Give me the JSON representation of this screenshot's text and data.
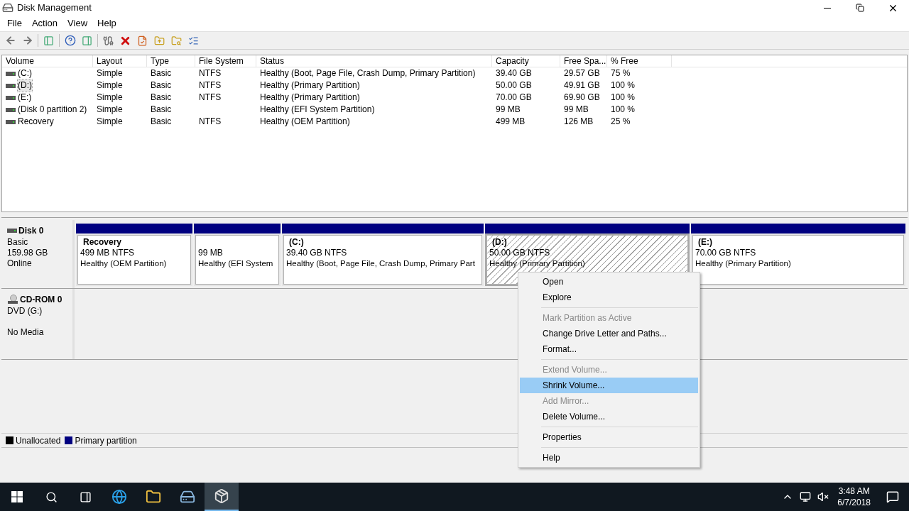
{
  "window": {
    "title": "Disk Management"
  },
  "menu": [
    "File",
    "Action",
    "View",
    "Help"
  ],
  "volumes": {
    "columns": [
      "Volume",
      "Layout",
      "Type",
      "File System",
      "Status",
      "Capacity",
      "Free Spa...",
      "% Free"
    ],
    "rows": [
      {
        "cells": [
          "(C:)",
          "Simple",
          "Basic",
          "NTFS",
          "Healthy (Boot, Page File, Crash Dump, Primary Partition)",
          "39.40 GB",
          "29.57 GB",
          "75 %"
        ],
        "selected": false
      },
      {
        "cells": [
          "(D:)",
          "Simple",
          "Basic",
          "NTFS",
          "Healthy (Primary Partition)",
          "50.00 GB",
          "49.91 GB",
          "100 %"
        ],
        "selected": true
      },
      {
        "cells": [
          "(E:)",
          "Simple",
          "Basic",
          "NTFS",
          "Healthy (Primary Partition)",
          "70.00 GB",
          "69.90 GB",
          "100 %"
        ],
        "selected": false
      },
      {
        "cells": [
          "(Disk 0 partition 2)",
          "Simple",
          "Basic",
          "",
          "Healthy (EFI System Partition)",
          "99 MB",
          "99 MB",
          "100 %"
        ],
        "selected": false
      },
      {
        "cells": [
          "Recovery",
          "Simple",
          "Basic",
          "NTFS",
          "Healthy (OEM Partition)",
          "499 MB",
          "126 MB",
          "25 %"
        ],
        "selected": false
      }
    ]
  },
  "disks": [
    {
      "kind": "disk",
      "name": "Disk 0",
      "info": [
        "Basic",
        "159.98 GB",
        "Online"
      ],
      "partitions": [
        {
          "label": "Recovery",
          "size": "499 MB NTFS",
          "status": "Healthy (OEM Partition)",
          "selected": false
        },
        {
          "size": "99 MB",
          "status": "Healthy (EFI System",
          "selected": false
        },
        {
          "label": "(C:)",
          "size": "39.40 GB NTFS",
          "status": "Healthy (Boot, Page File, Crash Dump, Primary Part",
          "selected": false
        },
        {
          "label": "(D:)",
          "size": "50.00 GB NTFS",
          "status": "Healthy (Primary Partition)",
          "selected": true
        },
        {
          "label": "(E:)",
          "size": "70.00 GB NTFS",
          "status": "Healthy (Primary Partition)",
          "selected": false
        }
      ]
    },
    {
      "kind": "cdrom",
      "name": "CD-ROM 0",
      "info": [
        "DVD (G:)",
        "No Media"
      ]
    }
  ],
  "legend": [
    {
      "label": "Unallocated",
      "color": "#000000"
    },
    {
      "label": "Primary partition",
      "color": "#000080"
    }
  ],
  "context_menu": [
    {
      "kind": "item",
      "label": "Open",
      "disabled": false,
      "selected": false
    },
    {
      "kind": "item",
      "label": "Explore",
      "disabled": false,
      "selected": false
    },
    {
      "kind": "separator"
    },
    {
      "kind": "item",
      "label": "Mark Partition as Active",
      "disabled": true,
      "selected": false
    },
    {
      "kind": "item",
      "label": "Change Drive Letter and Paths...",
      "disabled": false,
      "selected": false
    },
    {
      "kind": "item",
      "label": "Format...",
      "disabled": false,
      "selected": false
    },
    {
      "kind": "separator"
    },
    {
      "kind": "item",
      "label": "Extend Volume...",
      "disabled": true,
      "selected": false
    },
    {
      "kind": "item",
      "label": "Shrink Volume...",
      "disabled": false,
      "selected": true
    },
    {
      "kind": "item",
      "label": "Add Mirror...",
      "disabled": true,
      "selected": false
    },
    {
      "kind": "item",
      "label": "Delete Volume...",
      "disabled": false,
      "selected": false
    },
    {
      "kind": "separator"
    },
    {
      "kind": "item",
      "label": "Properties",
      "disabled": false,
      "selected": false
    },
    {
      "kind": "separator"
    },
    {
      "kind": "item",
      "label": "Help",
      "disabled": false,
      "selected": false
    }
  ],
  "taskbar": {
    "apps": [
      {
        "kind": "ie",
        "selected": false
      },
      {
        "kind": "explorer",
        "selected": false
      },
      {
        "kind": "drive",
        "selected": false
      },
      {
        "kind": "diskmgmt",
        "selected": true
      }
    ],
    "time": "3:48 AM",
    "date": "6/7/2018"
  }
}
